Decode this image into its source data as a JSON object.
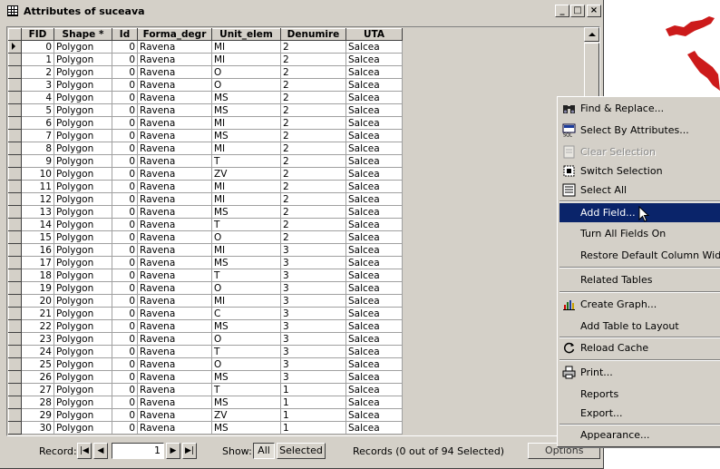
{
  "window": {
    "title": "Attributes of suceava",
    "controls": [
      "_",
      "□",
      "×"
    ]
  },
  "table": {
    "columns": [
      "FID",
      "Shape *",
      "Id",
      "Forma_degr",
      "Unit_elem",
      "Denumire",
      "UTA"
    ],
    "rows": [
      [
        "0",
        "Polygon",
        "0",
        "Ravena",
        "MI",
        "2",
        "Salcea"
      ],
      [
        "1",
        "Polygon",
        "0",
        "Ravena",
        "MI",
        "2",
        "Salcea"
      ],
      [
        "2",
        "Polygon",
        "0",
        "Ravena",
        "O",
        "2",
        "Salcea"
      ],
      [
        "3",
        "Polygon",
        "0",
        "Ravena",
        "O",
        "2",
        "Salcea"
      ],
      [
        "4",
        "Polygon",
        "0",
        "Ravena",
        "MS",
        "2",
        "Salcea"
      ],
      [
        "5",
        "Polygon",
        "0",
        "Ravena",
        "MS",
        "2",
        "Salcea"
      ],
      [
        "6",
        "Polygon",
        "0",
        "Ravena",
        "MI",
        "2",
        "Salcea"
      ],
      [
        "7",
        "Polygon",
        "0",
        "Ravena",
        "MS",
        "2",
        "Salcea"
      ],
      [
        "8",
        "Polygon",
        "0",
        "Ravena",
        "MI",
        "2",
        "Salcea"
      ],
      [
        "9",
        "Polygon",
        "0",
        "Ravena",
        "T",
        "2",
        "Salcea"
      ],
      [
        "10",
        "Polygon",
        "0",
        "Ravena",
        "ZV",
        "2",
        "Salcea"
      ],
      [
        "11",
        "Polygon",
        "0",
        "Ravena",
        "MI",
        "2",
        "Salcea"
      ],
      [
        "12",
        "Polygon",
        "0",
        "Ravena",
        "MI",
        "2",
        "Salcea"
      ],
      [
        "13",
        "Polygon",
        "0",
        "Ravena",
        "MS",
        "2",
        "Salcea"
      ],
      [
        "14",
        "Polygon",
        "0",
        "Ravena",
        "T",
        "2",
        "Salcea"
      ],
      [
        "15",
        "Polygon",
        "0",
        "Ravena",
        "O",
        "2",
        "Salcea"
      ],
      [
        "16",
        "Polygon",
        "0",
        "Ravena",
        "MI",
        "3",
        "Salcea"
      ],
      [
        "17",
        "Polygon",
        "0",
        "Ravena",
        "MS",
        "3",
        "Salcea"
      ],
      [
        "18",
        "Polygon",
        "0",
        "Ravena",
        "T",
        "3",
        "Salcea"
      ],
      [
        "19",
        "Polygon",
        "0",
        "Ravena",
        "O",
        "3",
        "Salcea"
      ],
      [
        "20",
        "Polygon",
        "0",
        "Ravena",
        "MI",
        "3",
        "Salcea"
      ],
      [
        "21",
        "Polygon",
        "0",
        "Ravena",
        "C",
        "3",
        "Salcea"
      ],
      [
        "22",
        "Polygon",
        "0",
        "Ravena",
        "MS",
        "3",
        "Salcea"
      ],
      [
        "23",
        "Polygon",
        "0",
        "Ravena",
        "O",
        "3",
        "Salcea"
      ],
      [
        "24",
        "Polygon",
        "0",
        "Ravena",
        "T",
        "3",
        "Salcea"
      ],
      [
        "25",
        "Polygon",
        "0",
        "Ravena",
        "O",
        "3",
        "Salcea"
      ],
      [
        "26",
        "Polygon",
        "0",
        "Ravena",
        "MS",
        "3",
        "Salcea"
      ],
      [
        "27",
        "Polygon",
        "0",
        "Ravena",
        "T",
        "1",
        "Salcea"
      ],
      [
        "28",
        "Polygon",
        "0",
        "Ravena",
        "MS",
        "1",
        "Salcea"
      ],
      [
        "29",
        "Polygon",
        "0",
        "Ravena",
        "ZV",
        "1",
        "Salcea"
      ],
      [
        "30",
        "Polygon",
        "0",
        "Ravena",
        "MS",
        "1",
        "Salcea"
      ]
    ]
  },
  "status": {
    "record_label": "Record:",
    "record_value": "1",
    "show_label": "Show:",
    "all_label": "All",
    "selected_label": "Selected",
    "records_text": "Records (0 out of 94 Selected)",
    "options_label": "Options"
  },
  "menu": {
    "items": [
      {
        "label": "Find & Replace...",
        "icon": "binoculars-icon"
      },
      {
        "label": "Select By Attributes...",
        "icon": "sql-icon"
      },
      {
        "label": "Clear Selection",
        "icon": "clear-selection-icon",
        "disabled": true
      },
      {
        "label": "Switch Selection",
        "icon": "switch-selection-icon"
      },
      {
        "label": "Select All",
        "icon": "select-all-icon"
      },
      {
        "label": "Add Field...",
        "highlighted": true
      },
      {
        "label": "Turn All Fields On"
      },
      {
        "label": "Restore Default Column Widths"
      },
      {
        "label": "Related Tables"
      },
      {
        "label": "Create Graph...",
        "icon": "graph-icon"
      },
      {
        "label": "Add Table to Layout"
      },
      {
        "label": "Reload Cache",
        "icon": "reload-icon"
      },
      {
        "label": "Print...",
        "icon": "printer-icon"
      },
      {
        "label": "Reports"
      },
      {
        "label": "Export..."
      },
      {
        "label": "Appearance..."
      }
    ]
  },
  "colors": {
    "menu_highlight": "#0a246a",
    "map_feature": "#cc1a1a",
    "chrome": "#d4d0c8"
  }
}
